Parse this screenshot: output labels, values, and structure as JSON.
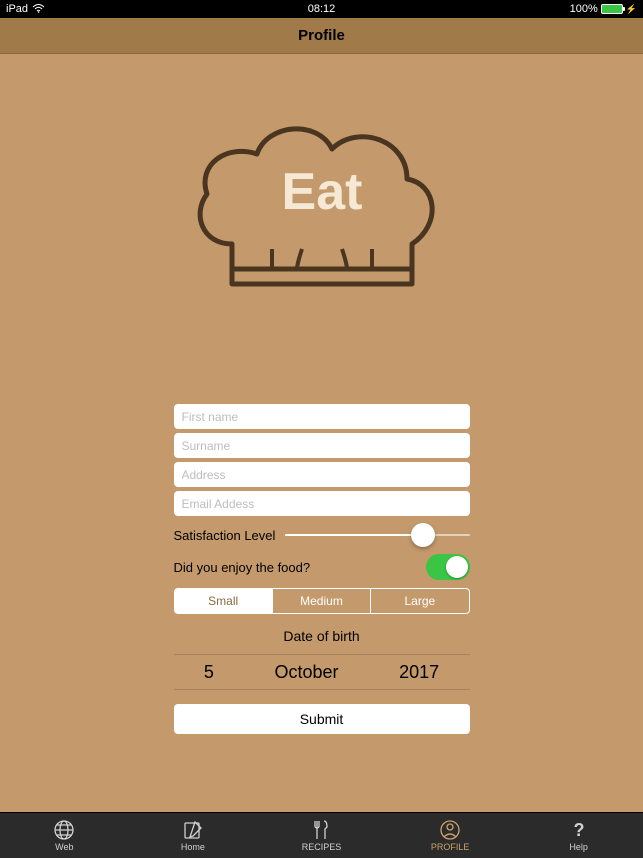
{
  "status": {
    "carrier": "iPad",
    "time": "08:12",
    "battery_pct": "100%"
  },
  "nav": {
    "title": "Profile"
  },
  "logo": {
    "text": "Eat"
  },
  "form": {
    "first_name_placeholder": "First name",
    "surname_placeholder": "Surname",
    "address_placeholder": "Address",
    "email_placeholder": "Email Addess",
    "satisfaction_label": "Satisfaction Level",
    "enjoy_label": "Did you enjoy the food?",
    "segments": {
      "small": "Small",
      "medium": "Medium",
      "large": "Large",
      "selected": "Small"
    },
    "dob_label": "Date of birth",
    "dob": {
      "day": "5",
      "month": "October",
      "year": "2017"
    },
    "submit_label": "Submit"
  },
  "tabs": {
    "web": "Web",
    "home": "Home",
    "recipes": "RECIPES",
    "profile": "PROFILE",
    "help": "Help"
  }
}
